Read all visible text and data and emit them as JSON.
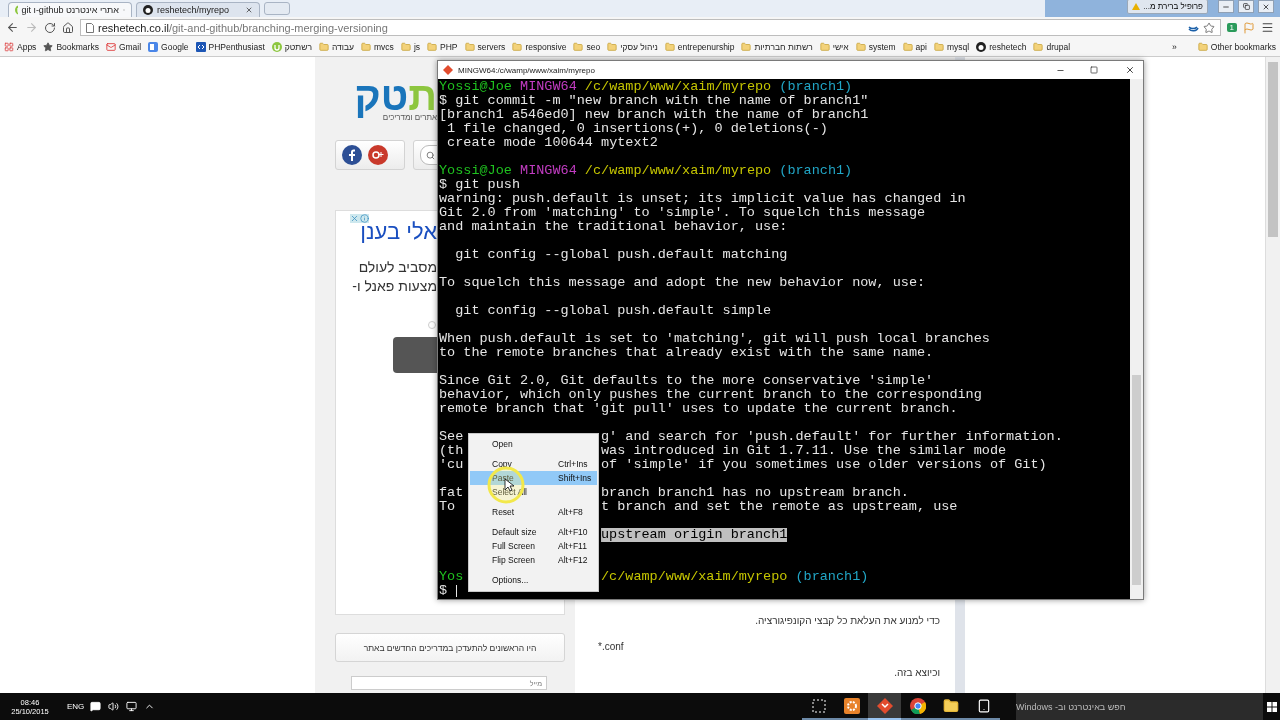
{
  "browser": {
    "tabs": [
      {
        "title": "git ו-github אתרי אינטרנט",
        "kind": "site",
        "selected": true
      },
      {
        "title": "reshetech/myrepo",
        "kind": "github",
        "selected": false
      }
    ],
    "profile": "פרופיל ברירת מ...",
    "url": {
      "host": "reshetech.co.il",
      "path": "/git-and-github/branching-merging-versioning"
    },
    "extension_badge": "1",
    "bookmarks": [
      {
        "label": "Apps",
        "kind": "apps"
      },
      {
        "label": "Bookmarks",
        "kind": "star"
      },
      {
        "label": "Gmail",
        "kind": "mail"
      },
      {
        "label": "Google",
        "kind": "google"
      },
      {
        "label": "PHPenthusiast",
        "kind": "php"
      },
      {
        "label": "רשתטק",
        "kind": "site"
      },
      {
        "label": "עבודה",
        "kind": "folder"
      },
      {
        "label": "mvcs",
        "kind": "folder"
      },
      {
        "label": "js",
        "kind": "folder"
      },
      {
        "label": "PHP",
        "kind": "folder"
      },
      {
        "label": "servers",
        "kind": "folder"
      },
      {
        "label": "responsive",
        "kind": "folder"
      },
      {
        "label": "seo",
        "kind": "folder"
      },
      {
        "label": "ניהול עסקי",
        "kind": "folder"
      },
      {
        "label": "entrepenurship",
        "kind": "folder"
      },
      {
        "label": "רשתות חברתיות",
        "kind": "folder"
      },
      {
        "label": "אישי",
        "kind": "folder"
      },
      {
        "label": "system",
        "kind": "folder"
      },
      {
        "label": "api",
        "kind": "folder"
      },
      {
        "label": "mysql",
        "kind": "folder"
      },
      {
        "label": "reshetech",
        "kind": "github"
      },
      {
        "label": "drupal",
        "kind": "folder"
      }
    ],
    "more_bookmarks": "»",
    "other_bookmarks": "Other bookmarks"
  },
  "page": {
    "logo": [
      {
        "text": "ת",
        "color": "#8dc63f"
      },
      {
        "text": "טק",
        "color": "#1a75bb"
      }
    ],
    "tagline": "אתרים ומדריכים",
    "ad": {
      "title": "אלי בענן",
      "lines": [
        "מסביב לעולם",
        "מצעות פאנל ו-"
      ]
    },
    "newsletter": {
      "title": "היו הראשונים להתעדכן במדריכים החדשים באתר",
      "email_placeholder": "מייל"
    },
    "article": [
      {
        "kind": "text",
        "text": "כדי למנוע את העלאת כל קבצי הקונפיגורציה."
      },
      {
        "kind": "code",
        "text": "*.conf"
      },
      {
        "kind": "text",
        "text": "וכיוצא בזה."
      }
    ]
  },
  "terminal": {
    "title": "MINGW64:/c/wamp/www/xaim/myrepo",
    "lines": [
      {
        "kind": "prompt",
        "user": "Yossi@Joe",
        "host": "MINGW64",
        "path": "/c/wamp/www/xaim/myrepo",
        "branch": "(branch1)"
      },
      {
        "kind": "text",
        "text": "$ git commit -m \"new branch with the name of branch1\""
      },
      {
        "kind": "text",
        "text": "[branch1 a546ed0] new branch with the name of branch1"
      },
      {
        "kind": "text",
        "text": " 1 file changed, 0 insertions(+), 0 deletions(-)"
      },
      {
        "kind": "text",
        "text": " create mode 100644 mytext2"
      },
      {
        "kind": "blank"
      },
      {
        "kind": "prompt",
        "user": "Yossi@Joe",
        "host": "MINGW64",
        "path": "/c/wamp/www/xaim/myrepo",
        "branch": "(branch1)"
      },
      {
        "kind": "text",
        "text": "$ git push"
      },
      {
        "kind": "text",
        "text": "warning: push.default is unset; its implicit value has changed in"
      },
      {
        "kind": "text",
        "text": "Git 2.0 from 'matching' to 'simple'. To squelch this message"
      },
      {
        "kind": "text",
        "text": "and maintain the traditional behavior, use:"
      },
      {
        "kind": "blank"
      },
      {
        "kind": "text",
        "text": "  git config --global push.default matching"
      },
      {
        "kind": "blank"
      },
      {
        "kind": "text",
        "text": "To squelch this message and adopt the new behavior now, use:"
      },
      {
        "kind": "blank"
      },
      {
        "kind": "text",
        "text": "  git config --global push.default simple"
      },
      {
        "kind": "blank"
      },
      {
        "kind": "text",
        "text": "When push.default is set to 'matching', git will push local branches"
      },
      {
        "kind": "text",
        "text": "to the remote branches that already exist with the same name."
      },
      {
        "kind": "blank"
      },
      {
        "kind": "text",
        "text": "Since Git 2.0, Git defaults to the more conservative 'simple'"
      },
      {
        "kind": "text",
        "text": "behavior, which only pushes the current branch to the corresponding"
      },
      {
        "kind": "text",
        "text": "remote branch that 'git pull' uses to update the current branch."
      },
      {
        "kind": "blank"
      },
      {
        "kind": "split",
        "left": "See",
        "right": "g' and search for 'push.default' for further information."
      },
      {
        "kind": "split",
        "left": "(th",
        "right": "was introduced in Git 1.7.11. Use the similar mode"
      },
      {
        "kind": "split",
        "left": "'cu",
        "right": "of 'simple' if you sometimes use older versions of Git)"
      },
      {
        "kind": "blank"
      },
      {
        "kind": "split",
        "left": "fat",
        "right": "branch branch1 has no upstream branch."
      },
      {
        "kind": "split",
        "left": "To",
        "right": "t branch and set the remote as upstream, use"
      },
      {
        "kind": "blank"
      },
      {
        "kind": "selection",
        "right": "upstream origin branch1"
      },
      {
        "kind": "blank"
      },
      {
        "kind": "blank"
      },
      {
        "kind": "prompt_split",
        "left": "Yos",
        "path": "/c/wamp/www/xaim/myrepo",
        "branch": "(branch1)"
      },
      {
        "kind": "input",
        "text": "$"
      }
    ]
  },
  "context_menu": [
    {
      "kind": "item",
      "label": "Open",
      "selected": false
    },
    {
      "kind": "separator"
    },
    {
      "kind": "item",
      "label": "Copy",
      "shortcut": "Ctrl+Ins",
      "selected": false
    },
    {
      "kind": "item",
      "label": "Paste",
      "shortcut": "Shift+Ins",
      "selected": true
    },
    {
      "kind": "item",
      "label": "Select All",
      "selected": false
    },
    {
      "kind": "separator"
    },
    {
      "kind": "item",
      "label": "Reset",
      "shortcut": "Alt+F8",
      "selected": false
    },
    {
      "kind": "separator"
    },
    {
      "kind": "item",
      "label": "Default size",
      "shortcut": "Alt+F10",
      "selected": false
    },
    {
      "kind": "item",
      "label": "Full Screen",
      "shortcut": "Alt+F11",
      "selected": false
    },
    {
      "kind": "item",
      "label": "Flip Screen",
      "shortcut": "Alt+F12",
      "selected": false
    },
    {
      "kind": "separator"
    },
    {
      "kind": "item",
      "label": "Options...",
      "selected": false
    }
  ],
  "taskbar": {
    "time": "08:46",
    "date": "25/10/2015",
    "language": "ENG",
    "apps": [
      {
        "kind": "task_view",
        "selected": false
      },
      {
        "kind": "server",
        "selected": false
      },
      {
        "kind": "git",
        "selected": true
      },
      {
        "kind": "browser",
        "selected": false
      },
      {
        "kind": "files",
        "selected": false
      },
      {
        "kind": "tablet",
        "selected": false
      }
    ],
    "search": "חפש באינטרנט וב- Windows"
  }
}
